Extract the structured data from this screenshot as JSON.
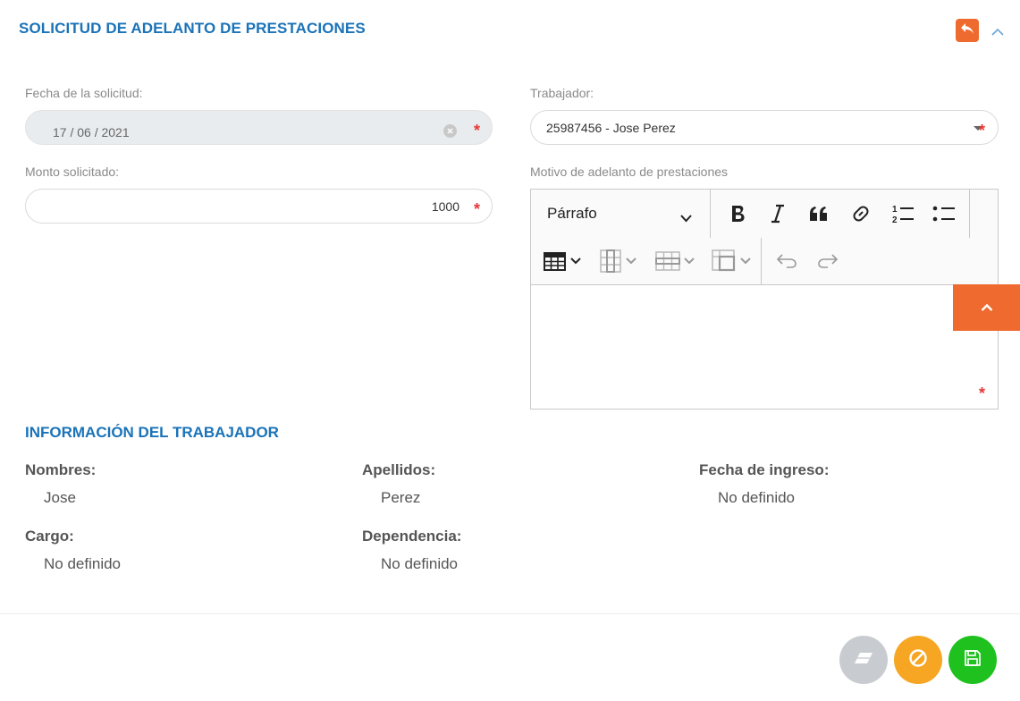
{
  "header": {
    "title": "SOLICITUD DE ADELANTO DE PRESTACIONES",
    "back_icon": "reply-icon",
    "collapse_icon": "chevron-up-icon"
  },
  "form": {
    "fecha": {
      "label": "Fecha de la solicitud:",
      "value": "17 / 06 / 2021",
      "required_mark": "*"
    },
    "trabajador": {
      "label": "Trabajador:",
      "value": "25987456 - Jose Perez",
      "required_mark": "*"
    },
    "monto": {
      "label": "Monto solicitado:",
      "value": "1000",
      "required_mark": "*"
    },
    "motivo": {
      "label": "Motivo de adelanto de prestaciones",
      "paragraph_style": "Párrafo",
      "content": "",
      "required_mark": "*",
      "toolbar_icons": [
        "bold-icon",
        "italic-icon",
        "blockquote-icon",
        "link-icon",
        "numbered-list-icon",
        "bulleted-list-icon",
        "insert-table-icon",
        "table-column-icon",
        "table-row-icon",
        "merge-cells-icon",
        "undo-icon",
        "redo-icon"
      ]
    }
  },
  "worker_info": {
    "title": "INFORMACIÓN DEL TRABAJADOR",
    "nombres": {
      "label": "Nombres:",
      "value": "Jose"
    },
    "apellidos": {
      "label": "Apellidos:",
      "value": "Perez"
    },
    "fecha_ingreso": {
      "label": "Fecha de ingreso:",
      "value": "No definido"
    },
    "cargo": {
      "label": "Cargo:",
      "value": "No definido"
    },
    "dependencia": {
      "label": "Dependencia:",
      "value": "No definido"
    }
  },
  "footer": {
    "clear_icon": "eraser-icon",
    "cancel_icon": "cancel-icon",
    "save_icon": "save-icon"
  },
  "colors": {
    "accent_blue": "#1a73b8",
    "accent_orange": "#ef6a2f",
    "cancel_yellow": "#f6a623",
    "save_green": "#1fc11f",
    "clear_gray": "#c8ccd0",
    "required_red": "#e53935"
  }
}
